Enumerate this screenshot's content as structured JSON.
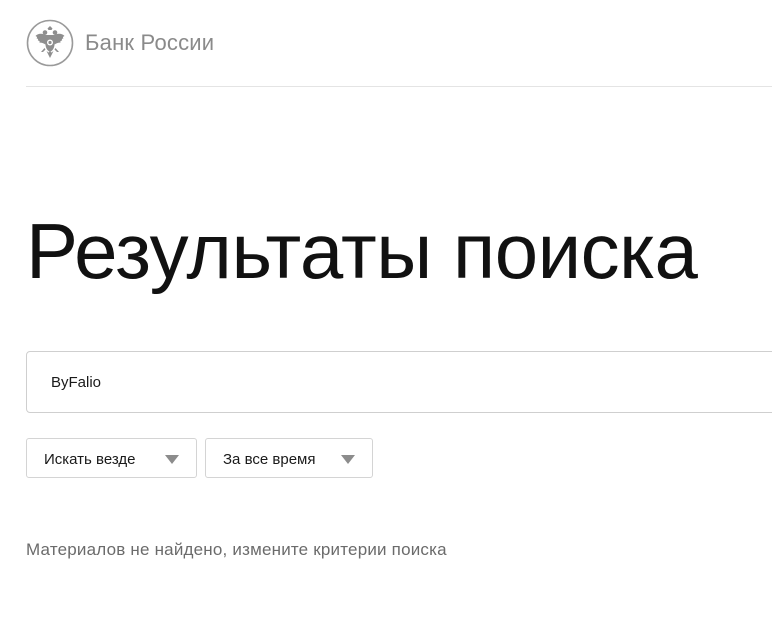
{
  "header": {
    "logo_text": "Банк России",
    "logo_icon": "double-headed-eagle-emblem"
  },
  "page": {
    "title": "Результаты поиска"
  },
  "search": {
    "value": "ByFalio",
    "placeholder": ""
  },
  "filters": {
    "scope": {
      "selected": "Искать везде",
      "icon": "chevron-down-icon"
    },
    "period": {
      "selected": "За все время",
      "icon": "chevron-down-icon"
    }
  },
  "results": {
    "empty_message": "Материалов не найдено, измените критерии поиска"
  },
  "colors": {
    "brand_text": "#8a8a8a",
    "title": "#111111",
    "border": "#cfcfcf",
    "message": "#6b6b6b",
    "chevron": "#8c8c8c"
  }
}
